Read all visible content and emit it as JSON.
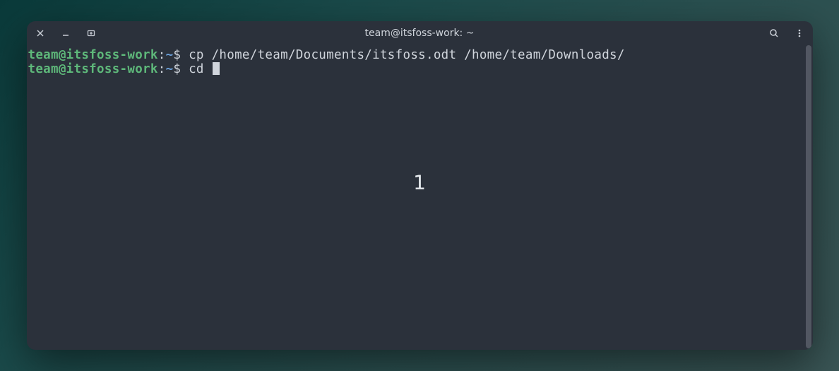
{
  "titlebar": {
    "title": "team@itsfoss-work: ~"
  },
  "terminal": {
    "lines": [
      {
        "userhost": "team@itsfoss-work",
        "colon": ":",
        "path": "~",
        "dollar": "$ ",
        "command": "cp /home/team/Documents/itsfoss.odt /home/team/Downloads/"
      },
      {
        "userhost": "team@itsfoss-work",
        "colon": ":",
        "path": "~",
        "dollar": "$ ",
        "command": "cd "
      }
    ]
  },
  "overlay": {
    "center_text": "1"
  }
}
